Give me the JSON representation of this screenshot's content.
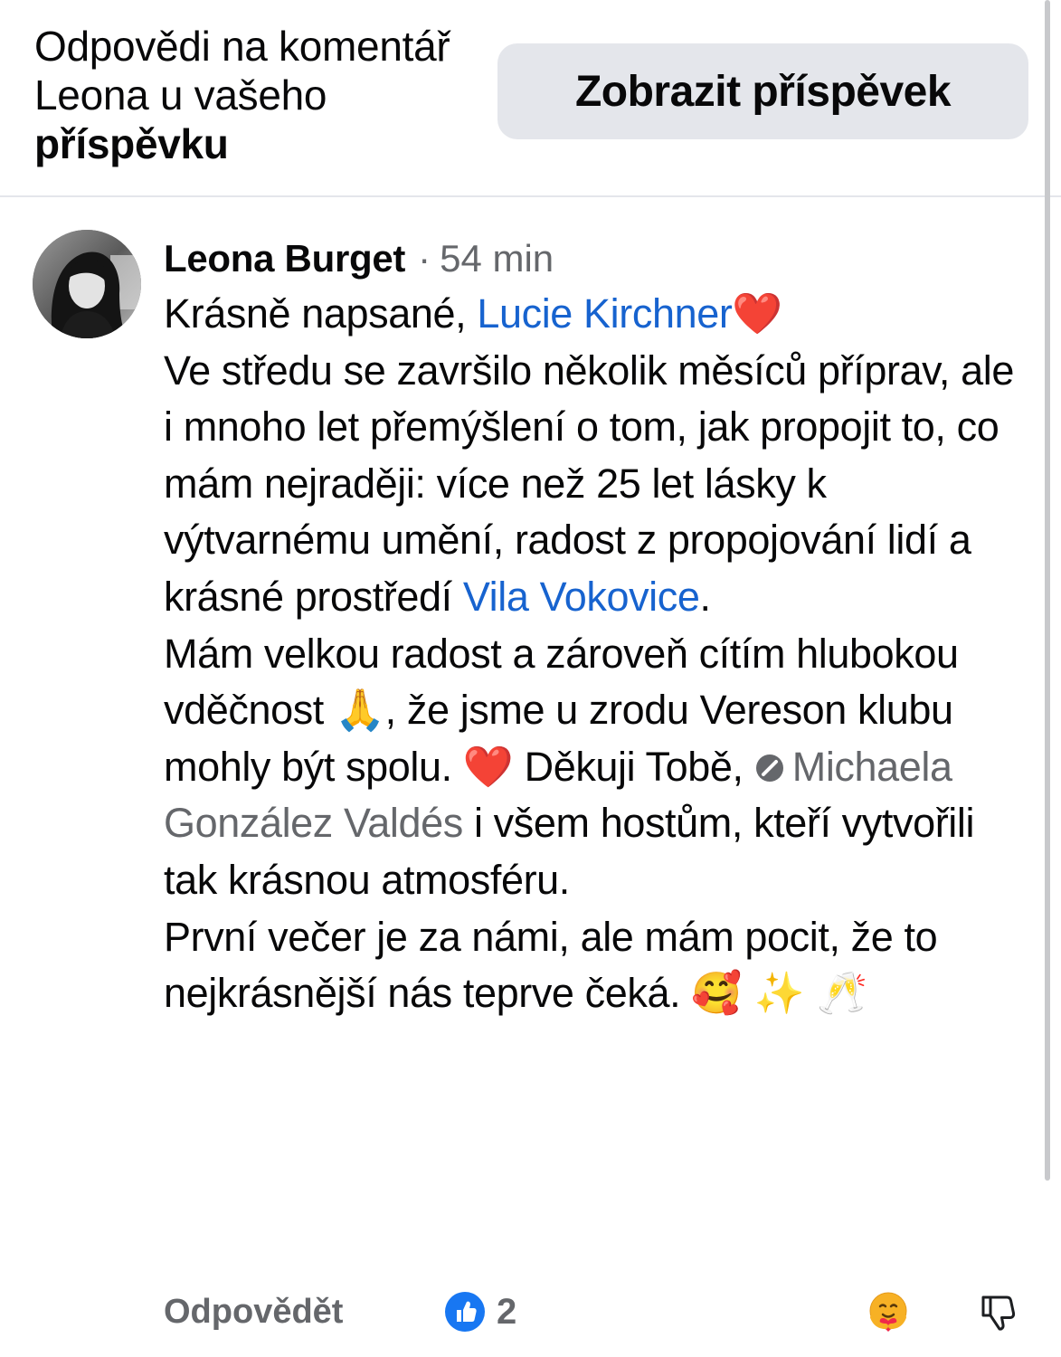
{
  "header": {
    "title_regular": "Odpovědi na komentář Leona u vašeho ",
    "title_bold": "příspěvku",
    "view_post_label": "Zobrazit příspěvek"
  },
  "comment": {
    "author": "Leona Burget",
    "separator": "·",
    "time": "54 min",
    "p1_text": "Krásně napsané, ",
    "p1_mention": "Lucie Kirchner",
    "p1_emoji": "❤️",
    "p2_text": "Ve středu se završilo několik měsíců příprav, ale i mnoho let přemýšlení o tom, jak propojit to, co mám nejraději: více než 25 let lásky k výtvarnému umění, radost z propojování lidí a krásné prostředí ",
    "p2_mention": "Vila Vokovice",
    "p2_end": ".",
    "p3_text1": "Mám velkou radost a zároveň cítím hlubokou vděčnost ",
    "p3_emoji1": "🙏",
    "p3_text2": ", že jsme u zrodu Vereson klubu mohly být spolu. ",
    "p3_emoji2": "❤️",
    "p3_text3": " Děkuji Tobě, ",
    "p3_mention": "Michaela González Valdés",
    "p3_text4": " i všem hostům, kteří vytvořili tak krásnou atmosféru.",
    "p4_text": "První večer je za námi, ale mám pocit, že to nejkrásnější nás teprve čeká. ",
    "p4_emojis": "🥰 ✨ 🥂"
  },
  "footer": {
    "reply_label": "Odpovědět",
    "like_count": "2",
    "like_icon": "thumbs-up-icon",
    "react_icon": "care-reaction-icon",
    "dislike_icon": "thumbs-down-icon"
  },
  "colors": {
    "link_blue": "#1763cf",
    "muted_gray": "#65676b",
    "button_bg": "#e4e6eb",
    "like_blue": "#1877f2"
  }
}
